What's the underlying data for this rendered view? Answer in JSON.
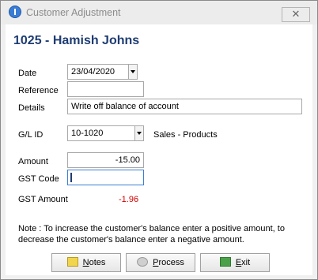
{
  "window": {
    "title": "Customer Adjustment",
    "close_glyph": "✕"
  },
  "header": {
    "customer": "1025 - Hamish Johns"
  },
  "form": {
    "date_label": "Date",
    "date_value": "23/04/2020",
    "reference_label": "Reference",
    "reference_value": "",
    "details_label": "Details",
    "details_value": "Write off balance of account",
    "gl_label": "G/L ID",
    "gl_value": "10-1020",
    "gl_desc": "Sales - Products",
    "amount_label": "Amount",
    "amount_value": "-15.00",
    "gst_code_label": "GST Code",
    "gst_code_value": "",
    "gst_amount_label": "GST Amount",
    "gst_amount_value": "-1.96"
  },
  "note": "Note : To increase the customer's balance enter a positive amount, to decrease the customer's balance enter a negative amount.",
  "buttons": {
    "notes_mn": "N",
    "notes_rest": "otes",
    "process_mn": "P",
    "process_rest": "rocess",
    "exit_mn": "E",
    "exit_rest": "xit"
  },
  "icons": [
    "app-icon",
    "notes-icon",
    "process-icon",
    "exit-icon"
  ]
}
